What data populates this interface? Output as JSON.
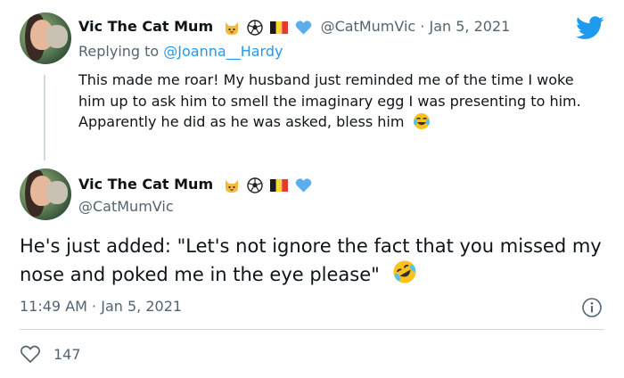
{
  "reply_tweet": {
    "author_name": "Vic The Cat Mum",
    "handle": "@CatMumVic",
    "separator": "·",
    "date": "Jan 5, 2021",
    "replying_prefix": "Replying to",
    "replying_handle": "@Joanna__Hardy",
    "text": "This made me roar! My husband just reminded me of the time I woke him up to ask him to smell the imaginary egg I was presenting to him. Apparently he did as he was asked, bless him"
  },
  "main_tweet": {
    "author_name": "Vic The Cat Mum",
    "handle": "@CatMumVic",
    "text": "He's just added: \"Let's not ignore the fact that you missed my nose and poked me in the eye please\"",
    "time": "11:49 AM",
    "separator": "·",
    "date": "Jan 5, 2021"
  },
  "stats": {
    "likes": "147"
  },
  "icons": {
    "name_emojis": [
      "cat-face-icon",
      "soccer-ball-icon",
      "belgium-flag-icon",
      "blue-heart-icon"
    ],
    "reply_end_emoji": "face-with-tears-of-joy-icon",
    "main_end_emoji": "rolling-on-floor-laughing-icon",
    "brand": "twitter-bird-icon",
    "info": "info-icon",
    "like": "heart-outline-icon"
  },
  "colors": {
    "text": "#0f1419",
    "secondary": "#536471",
    "link": "#1d9bf0",
    "twitter_blue": "#1d9bf0",
    "divider": "#cfd9de"
  }
}
